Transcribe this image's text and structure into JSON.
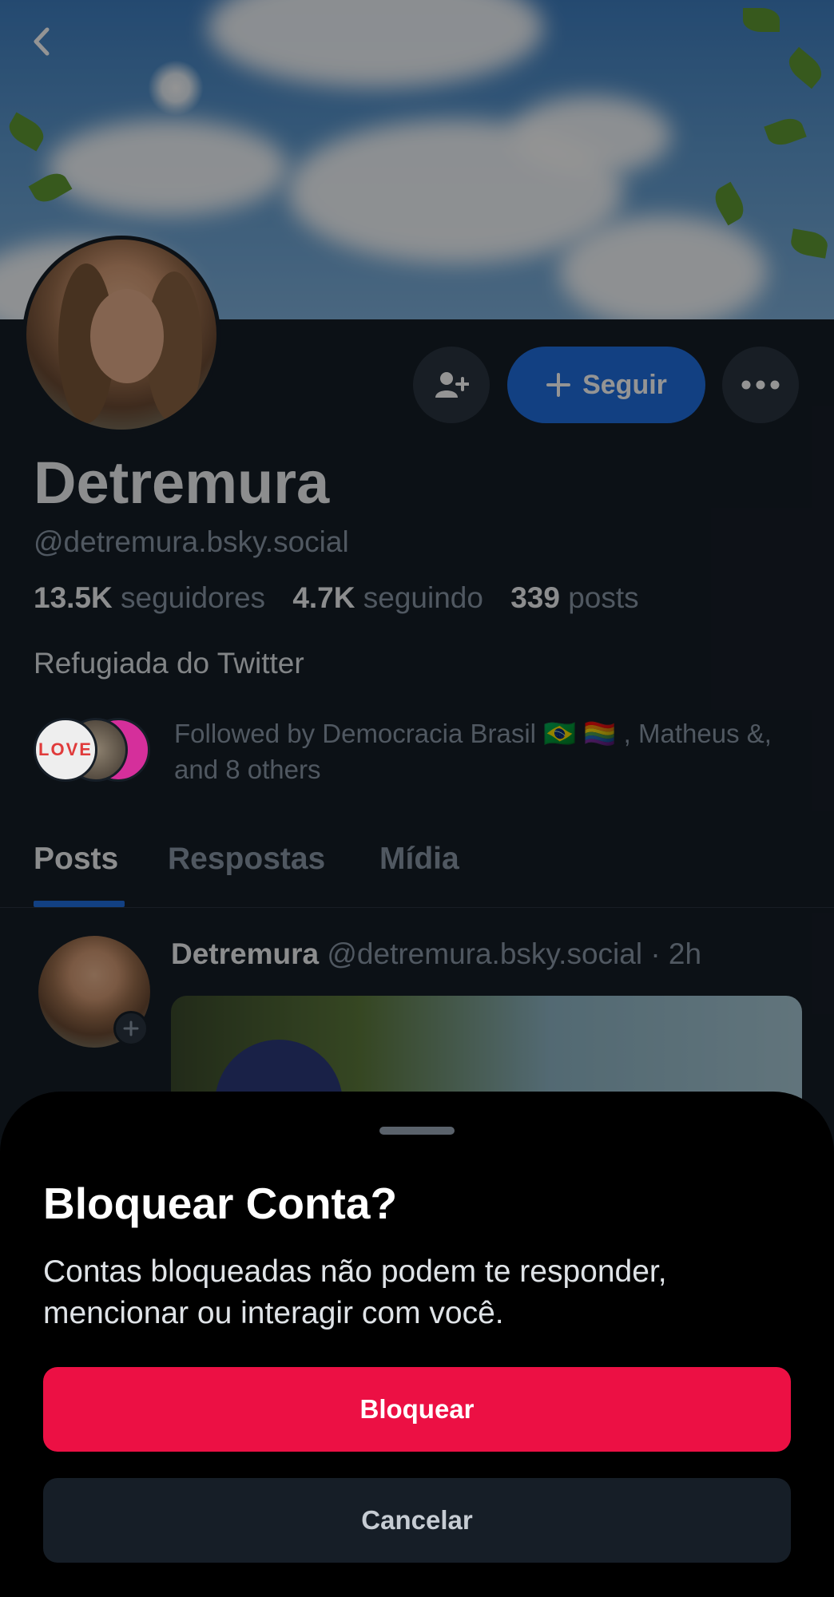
{
  "profile": {
    "display_name": "Detremura",
    "handle": "@detremura.bsky.social",
    "bio": "Refugiada do Twitter",
    "stats": {
      "followers_count": "13.5K",
      "followers_label": "seguidores",
      "following_count": "4.7K",
      "following_label": "seguindo",
      "posts_count": "339",
      "posts_label": "posts"
    },
    "follow_button_label": "Seguir",
    "followed_by_text": "Followed by Democracia Brasil 🇧🇷 🏳️‍🌈 , Matheus &, and 8 others",
    "love_badge": [
      "LOVE"
    ]
  },
  "tabs": [
    "Posts",
    "Respostas",
    "Mídia"
  ],
  "active_tab": "Posts",
  "post": {
    "author": "Detremura",
    "handle": "@detremura.bsky.social",
    "time": "· 2h"
  },
  "sheet": {
    "title": "Bloquear Conta?",
    "message": "Contas bloqueadas não podem te responder, mencionar ou interagir com você.",
    "confirm_label": "Bloquear",
    "cancel_label": "Cancelar"
  },
  "colors": {
    "accent": "#1f6fe0",
    "danger": "#ec1044",
    "background": "#161e27",
    "sheet": "#000000"
  },
  "icons": [
    "chevron-left-icon",
    "add-user-icon",
    "plus-icon",
    "more-dots-icon"
  ]
}
